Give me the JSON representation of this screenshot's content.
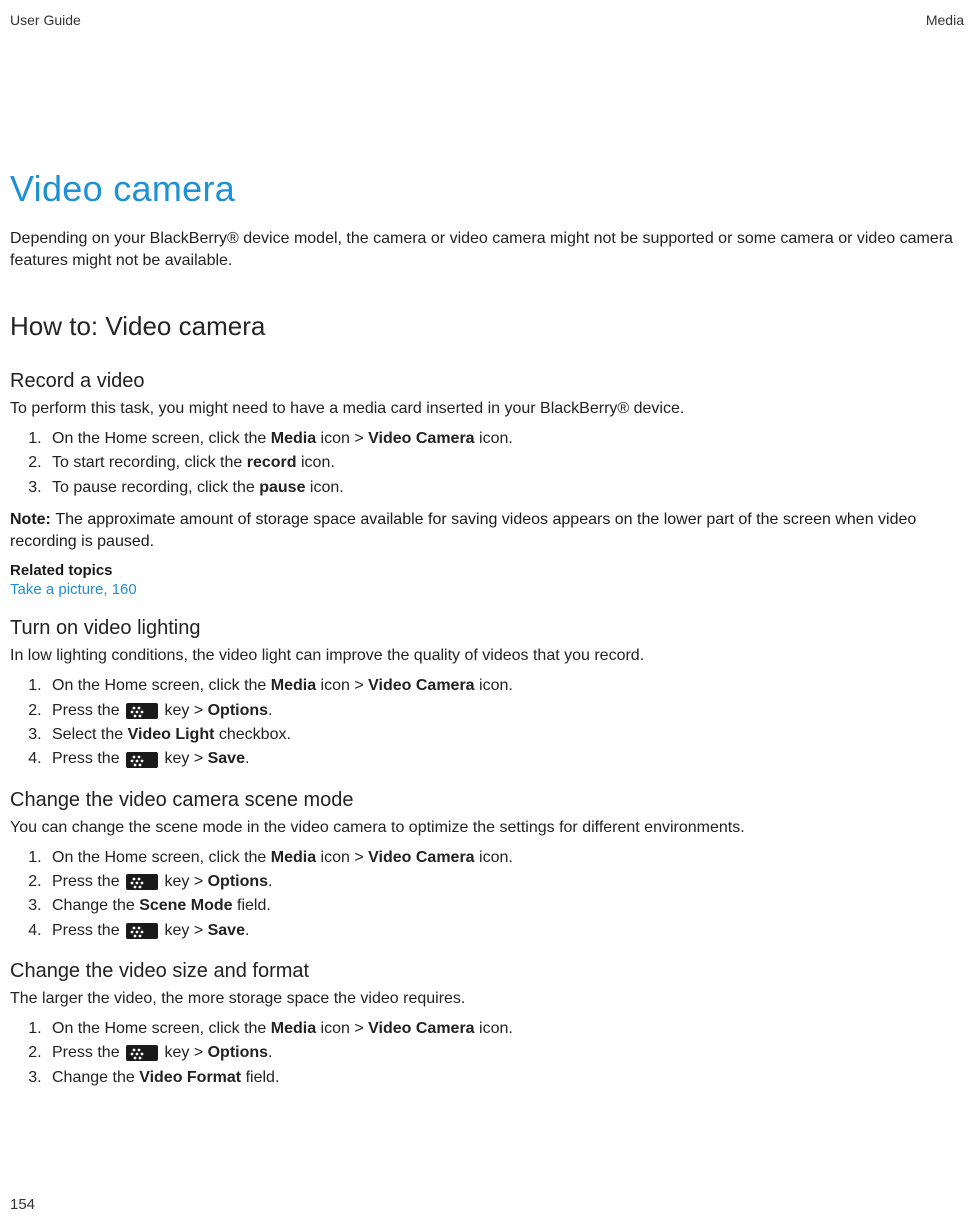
{
  "header": {
    "left": "User Guide",
    "right": "Media"
  },
  "title": "Video camera",
  "intro": "Depending on your BlackBerry® device model, the camera or video camera might not be supported or some camera or video camera features might not be available.",
  "h2": "How to: Video camera",
  "sections": {
    "record": {
      "heading": "Record a video",
      "intro": "To perform this task, you might need to have a media card inserted in your BlackBerry® device.",
      "steps": {
        "s1": {
          "pre": "On the Home screen, click the ",
          "b1": "Media",
          "mid": " icon > ",
          "b2": "Video Camera",
          "post": " icon."
        },
        "s2": {
          "pre": "To start recording, click the ",
          "b1": "record",
          "post": " icon."
        },
        "s3": {
          "pre": "To pause recording, click the ",
          "b1": "pause",
          "post": " icon."
        }
      },
      "note": {
        "label": "Note: ",
        "text": "The approximate amount of storage space available for saving videos appears on the lower part of the screen when video recording is paused."
      },
      "related": {
        "heading": "Related topics",
        "link": "Take a picture, 160"
      }
    },
    "lighting": {
      "heading": "Turn on video lighting",
      "intro": "In low lighting conditions, the video light can improve the quality of videos that you record.",
      "steps": {
        "s1": {
          "pre": "On the Home screen, click the ",
          "b1": "Media",
          "mid": " icon > ",
          "b2": "Video Camera",
          "post": " icon."
        },
        "s2": {
          "pre": "Press the ",
          "mid": " key > ",
          "b1": "Options",
          "post": "."
        },
        "s3": {
          "pre": "Select the ",
          "b1": "Video Light",
          "post": " checkbox."
        },
        "s4": {
          "pre": "Press the ",
          "mid": " key > ",
          "b1": "Save",
          "post": "."
        }
      }
    },
    "scene": {
      "heading": "Change the video camera scene mode",
      "intro": "You can change the scene mode in the video camera to optimize the settings for different environments.",
      "steps": {
        "s1": {
          "pre": "On the Home screen, click the ",
          "b1": "Media",
          "mid": " icon > ",
          "b2": "Video Camera",
          "post": " icon."
        },
        "s2": {
          "pre": "Press the ",
          "mid": " key > ",
          "b1": "Options",
          "post": "."
        },
        "s3": {
          "pre": "Change the ",
          "b1": "Scene Mode",
          "post": " field."
        },
        "s4": {
          "pre": "Press the ",
          "mid": " key > ",
          "b1": "Save",
          "post": "."
        }
      }
    },
    "size": {
      "heading": "Change the video size and format",
      "intro": "The larger the video, the more storage space the video requires.",
      "steps": {
        "s1": {
          "pre": "On the Home screen, click the ",
          "b1": "Media",
          "mid": " icon > ",
          "b2": "Video Camera",
          "post": " icon."
        },
        "s2": {
          "pre": "Press the ",
          "mid": " key > ",
          "b1": "Options",
          "post": "."
        },
        "s3": {
          "pre": "Change the ",
          "b1": "Video Format",
          "post": " field."
        }
      }
    }
  },
  "pageNumber": "154",
  "icon": {
    "name": "blackberry-menu-key-icon"
  }
}
